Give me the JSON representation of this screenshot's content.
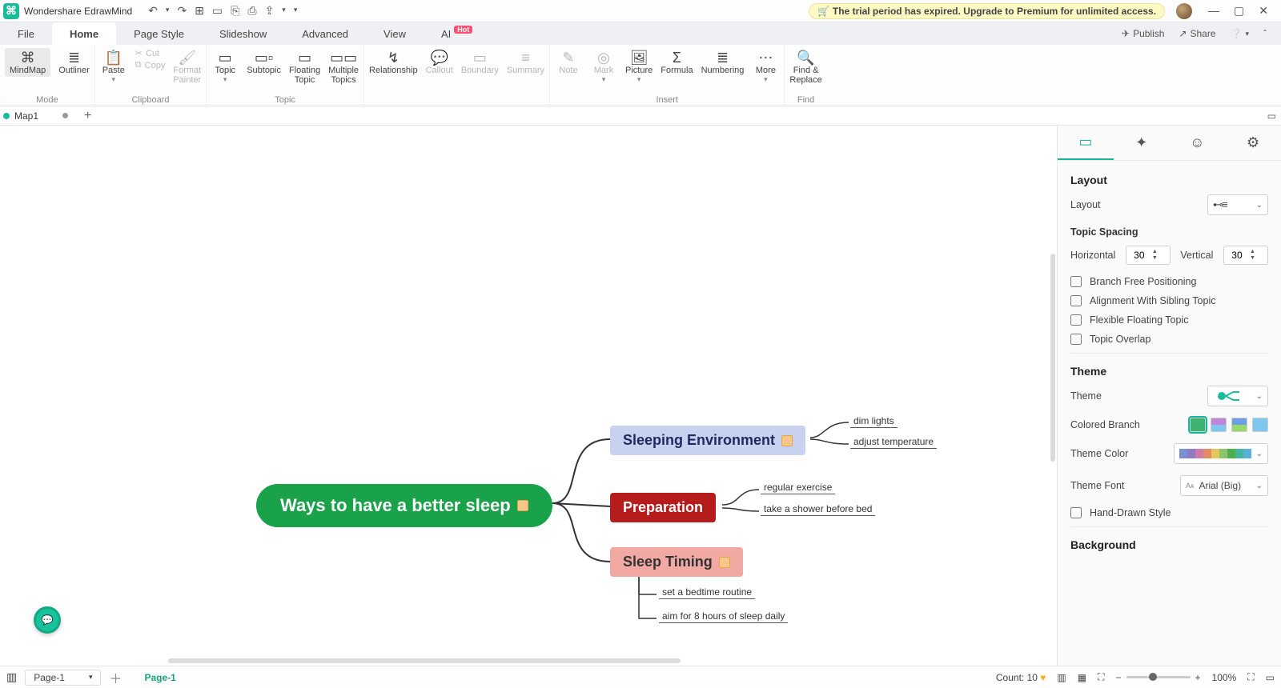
{
  "app": {
    "title": "Wondershare EdrawMind"
  },
  "trial_message": "The trial period has expired. Upgrade to Premium for unlimited access.",
  "menubar": {
    "tabs": {
      "file": "File",
      "home": "Home",
      "page_style": "Page Style",
      "slideshow": "Slideshow",
      "advanced": "Advanced",
      "view": "View",
      "ai": "AI",
      "ai_badge": "Hot"
    },
    "right": {
      "publish": "Publish",
      "share": "Share"
    }
  },
  "ribbon": {
    "mode": {
      "mindmap": "MindMap",
      "outliner": "Outliner",
      "group": "Mode"
    },
    "clipboard": {
      "paste": "Paste",
      "cut": "Cut",
      "copy": "Copy",
      "format_painter1": "Format",
      "format_painter2": "Painter",
      "group": "Clipboard"
    },
    "topic": {
      "topic": "Topic",
      "subtopic": "Subtopic",
      "floating1": "Floating",
      "floating2": "Topic",
      "multiple1": "Multiple",
      "multiple2": "Topics",
      "group": "Topic"
    },
    "relationship": "Relationship",
    "callout": "Callout",
    "boundary": "Boundary",
    "summary": "Summary",
    "insert": {
      "note": "Note",
      "mark": "Mark",
      "picture": "Picture",
      "formula": "Formula",
      "numbering": "Numbering",
      "more": "More",
      "group": "Insert"
    },
    "find": {
      "find1": "Find &",
      "find2": "Replace",
      "group": "Find"
    }
  },
  "doctabs": {
    "name": "Map1",
    "add": "+"
  },
  "mindmap": {
    "central": "Ways to have a  better sleep",
    "n1": "Sleeping Environment",
    "n2": "Preparation",
    "n3": "Sleep Timing",
    "l1": "dim lights",
    "l2": "adjust temperature",
    "l3": "regular exercise",
    "l4": "take a shower before bed",
    "l5": "set a bedtime routine",
    "l6": "aim for 8 hours of sleep daily"
  },
  "sidepanel": {
    "h_layout": "Layout",
    "layout_label": "Layout",
    "topic_spacing": "Topic Spacing",
    "horizontal": "Horizontal",
    "vertical": "Vertical",
    "hval": "30",
    "vval": "30",
    "chk_branch": "Branch Free Positioning",
    "chk_align": "Alignment With Sibling Topic",
    "chk_flex": "Flexible Floating Topic",
    "chk_overlap": "Topic Overlap",
    "h_theme": "Theme",
    "theme_label": "Theme",
    "colored_branch": "Colored Branch",
    "theme_color": "Theme Color",
    "theme_font": "Theme Font",
    "font_value": "Arial (Big)",
    "chk_hand": "Hand-Drawn Style",
    "h_background": "Background"
  },
  "statusbar": {
    "page_dropdown": "Page-1",
    "page_tab": "Page-1",
    "count_label": "Count:",
    "count_value": "10",
    "zoom": "100%"
  }
}
